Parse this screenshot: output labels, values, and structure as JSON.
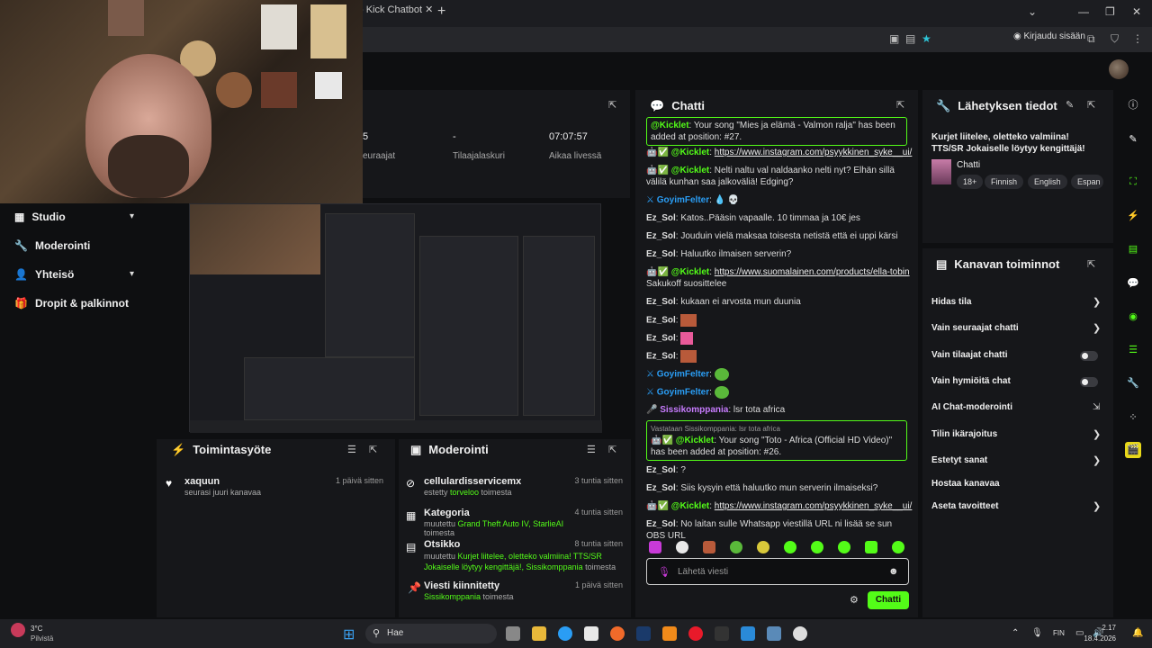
{
  "browser": {
    "tab_title": "- Kick Chatbot",
    "login_label": "Kirjaudu sisään"
  },
  "stats": [
    {
      "value": "5",
      "label": "euraajat"
    },
    {
      "value": "-",
      "label": "Tilaajalaskuri"
    },
    {
      "value": "07:07:57",
      "label": "Aikaa livessä"
    }
  ],
  "nav": [
    {
      "label": "Studio",
      "icon": "studio-icon",
      "has_chevron": true
    },
    {
      "label": "Moderointi",
      "icon": "wrench-icon",
      "has_chevron": false
    },
    {
      "label": "Yhteisö",
      "icon": "user-icon",
      "has_chevron": true
    },
    {
      "label": "Dropit & palkinnot",
      "icon": "gift-icon",
      "has_chevron": false
    }
  ],
  "activity": {
    "title": "Toimintasyöte",
    "items": [
      {
        "title": "xaquun",
        "sub": "seurasi juuri kanavaa",
        "time": "1 päivä sitten"
      }
    ]
  },
  "moderation": {
    "title": "Moderointi",
    "items": [
      {
        "title": "cellulardisservicemx",
        "pre": "estetty ",
        "who": "torveloo",
        "post": " toimesta",
        "time": "3 tuntia sitten"
      },
      {
        "title": "Kategoria",
        "pre": "muutettu ",
        "who": "Grand Theft Auto IV, StarlieAI",
        "post": " toimesta",
        "time": "4 tuntia sitten"
      },
      {
        "title": "Otsikko",
        "pre": "muutettu ",
        "who": "Kurjet liitelee, oletteko valmiina! TTS/SR Jokaiselle löytyy kengittäjä!, Sissikomppania",
        "post": " toimesta",
        "time": "8 tuntia sitten"
      },
      {
        "title": "Viesti kiinnitetty",
        "pre": "",
        "who": "Sissikomppania",
        "post": " toimesta",
        "time": "1 päivä sitten"
      }
    ]
  },
  "chat": {
    "title": "Chatti",
    "messages": [
      {
        "user": "@Kicklet",
        "color": "#53fc18",
        "text": ": Your song \"Mies ja elämä - Valmon ralja\" has been added at position: #27.",
        "hl": true
      },
      {
        "user": "@Kicklet",
        "color": "#53fc18",
        "link": "https://www.instagram.com/psyykkinen_syke__ui/"
      },
      {
        "user": "@Kicklet",
        "color": "#53fc18",
        "text": ": Nelti naltu val naldaanko nelti nyt? Elhän sillä välilä kunhan saa jalkoväliä! Edging?"
      },
      {
        "user": "GoyimFelter",
        "color": "#2a9df4",
        "text": ": 💧 💀"
      },
      {
        "user": "Ez_Sol",
        "color": "#e8e8e8",
        "text": ": Katos..Pääsin vapaalle. 10 timmaa ja 10€ jes"
      },
      {
        "user": "Ez_Sol",
        "color": "#e8e8e8",
        "text": ": Jouduin vielä maksaa toisesta netistä että ei uppi kärsi"
      },
      {
        "user": "Ez_Sol",
        "color": "#e8e8e8",
        "text": ": Haluutko ilmaisen serverin?"
      },
      {
        "user": "@Kicklet",
        "color": "#53fc18",
        "link": "https://www.suomalainen.com/products/ella-tobin",
        "text2": "Sakukoff suosittelee"
      },
      {
        "user": "Ez_Sol",
        "color": "#e8e8e8",
        "text": ": kukaan ei arvosta mun duunia"
      },
      {
        "user": "Ez_Sol",
        "color": "#e8e8e8",
        "text": ":"
      },
      {
        "user": "Ez_Sol",
        "color": "#e8e8e8",
        "text": ":"
      },
      {
        "user": "Ez_Sol",
        "color": "#e8e8e8",
        "text": ":"
      },
      {
        "user": "GoyimFelter",
        "color": "#2a9df4",
        "text": ":"
      },
      {
        "user": "GoyimFelter",
        "color": "#2a9df4",
        "text": ":"
      },
      {
        "user": "Sissikomppania",
        "color": "#c87cff",
        "text": ": lsr tota africa"
      },
      {
        "reply": "Vastataan Sissikomppania: lsr tota africa",
        "user": "@Kicklet",
        "color": "#53fc18",
        "text": ": Your song \"Toto - Africa (Official HD Video)\" has been added at position: #26.",
        "hl": true
      },
      {
        "user": "Ez_Sol",
        "color": "#e8e8e8",
        "text": ": ?"
      },
      {
        "user": "Ez_Sol",
        "color": "#e8e8e8",
        "text": ": Siis kysyin että haluutko mun serverin ilmaiseksi?"
      },
      {
        "user": "@Kicklet",
        "color": "#53fc18",
        "link": "https://www.instagram.com/psyykkinen_syke__ui/"
      },
      {
        "user": "Ez_Sol",
        "color": "#e8e8e8",
        "text": ": No laitan sulle Whatsapp viestillä URL ni lisää se sun OBS URL"
      }
    ],
    "input_placeholder": "Lähetä viesti",
    "send_label": "Chatti"
  },
  "stream_info": {
    "title": "Lähetyksen tiedot",
    "stream_title": "Kurjet liitelee, oletteko valmiina! TTS/SR Jokaiselle löytyy kengittäjä!",
    "category": "Chatti",
    "tags": [
      "18+",
      "Finnish",
      "English",
      "Espan"
    ]
  },
  "channel_actions": {
    "title": "Kanavan toiminnot",
    "items": [
      {
        "label": "Hidas tila",
        "control": "chevron"
      },
      {
        "label": "Vain seuraajat chatti",
        "control": "chevron"
      },
      {
        "label": "Vain tilaajat chatti",
        "control": "toggle"
      },
      {
        "label": "Vain hymiöitä chat",
        "control": "toggle"
      },
      {
        "label": "AI Chat-moderointi",
        "control": "external"
      },
      {
        "label": "Tilin ikärajoitus",
        "control": "chevron"
      },
      {
        "label": "Estetyt sanat",
        "control": "chevron"
      },
      {
        "label": "Hostaa kanavaa",
        "control": "none"
      },
      {
        "label": "Aseta tavoitteet",
        "control": "chevron"
      }
    ]
  },
  "taskbar": {
    "weather_temp": "3°C",
    "weather_desc": "Pilvistä",
    "search_label": "Hae",
    "lang": "FIN",
    "time": "2.17",
    "date": "18.4.2026"
  },
  "colors": {
    "accent": "#53fc18",
    "bg": "#0e0f11",
    "panel": "#16171a"
  }
}
